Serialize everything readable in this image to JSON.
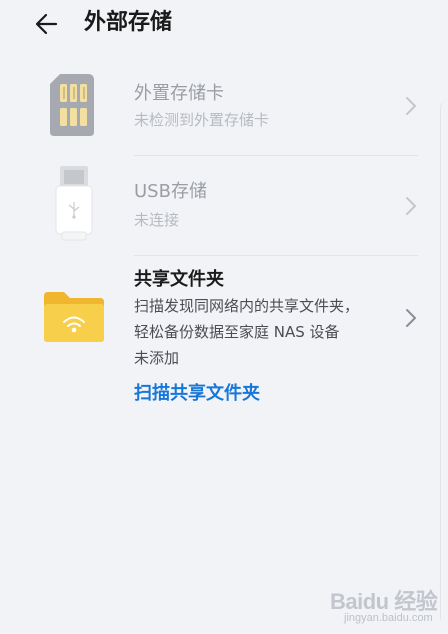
{
  "header": {
    "title": "外部存储",
    "back_icon": "arrow-left-icon"
  },
  "items": [
    {
      "icon": "sd-card-icon",
      "title": "外置存储卡",
      "subtitle": "未检测到外置存储卡",
      "enabled": false
    },
    {
      "icon": "usb-drive-icon",
      "title": "USB存储",
      "subtitle": "未连接",
      "enabled": false
    },
    {
      "icon": "shared-folder-icon",
      "title": "共享文件夹",
      "description_line1": "扫描发现同网络内的共享文件夹，",
      "description_line2": "轻松备份数据至家庭 NAS 设备",
      "status": "未添加",
      "action_label": "扫描共享文件夹",
      "enabled": true
    }
  ],
  "colors": {
    "background": "#f1f3f7",
    "link": "#1777d8",
    "folder": "#f5c842"
  },
  "watermark": {
    "text": "Baidu 经验",
    "url": "jingyan.baidu.com"
  }
}
